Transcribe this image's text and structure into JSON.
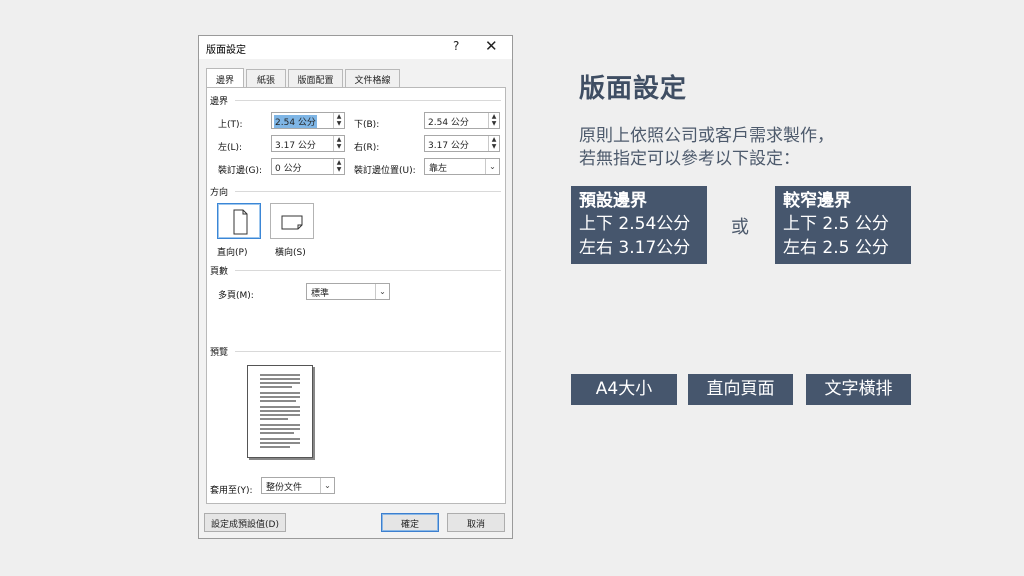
{
  "dialog": {
    "title": "版面設定",
    "help_glyph": "?",
    "close_glyph": "✕",
    "tabs": [
      "邊界",
      "紙張",
      "版面配置",
      "文件格線"
    ],
    "margins_section": "邊界",
    "top_label": "上(T):",
    "top_value": "2.54 公分",
    "bottom_label": "下(B):",
    "bottom_value": "2.54 公分",
    "left_label": "左(L):",
    "left_value": "3.17 公分",
    "right_label": "右(R):",
    "right_value": "3.17 公分",
    "gutter_label": "裝訂邊(G):",
    "gutter_value": "0 公分",
    "gutter_pos_label": "裝訂邊位置(U):",
    "gutter_pos_value": "靠左",
    "orientation_section": "方向",
    "portrait_label": "直向(P)",
    "landscape_label": "橫向(S)",
    "pages_section": "頁數",
    "multiple_pages_label": "多頁(M):",
    "multiple_pages_value": "標準",
    "preview_section": "預覽",
    "apply_to_label": "套用至(Y):",
    "apply_to_value": "整份文件",
    "set_default_button": "設定成預設值(D)",
    "ok_button": "確定",
    "cancel_button": "取消"
  },
  "slide": {
    "title": "版面設定",
    "description_line1": "原則上依照公司或客戶需求製作，",
    "description_line2": "若無指定可以參考以下設定：",
    "default_box": {
      "title": "預設邊界",
      "line1": "上下 2.54公分",
      "line2": "左右 3.17公分"
    },
    "or_text": "或",
    "narrow_box": {
      "title": "較窄邊界",
      "line1": "上下 2.5 公分",
      "line2": "左右 2.5 公分"
    },
    "tags": [
      "A4大小",
      "直向頁面",
      "文字橫排"
    ]
  }
}
